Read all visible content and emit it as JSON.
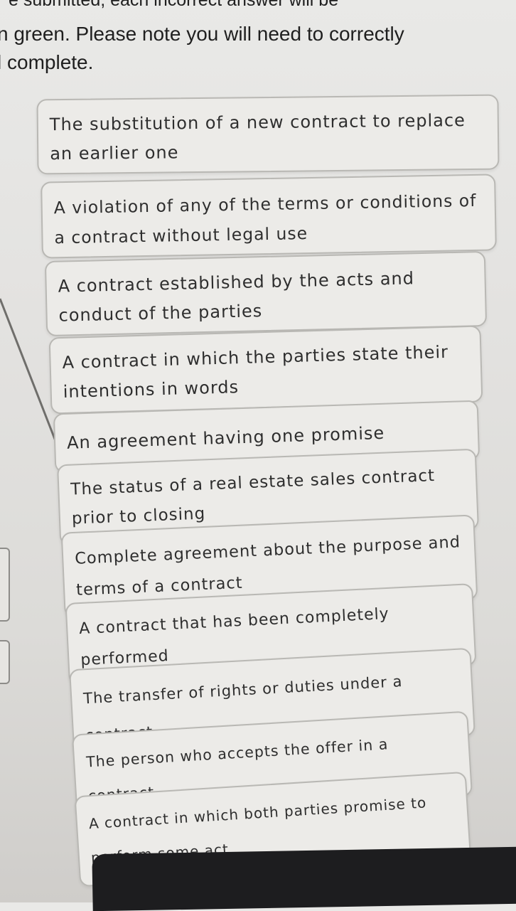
{
  "instructions": {
    "line1": "e submitted, each incorrect answer will be",
    "line2": "n green. Please note you will need to correctly",
    "line3": "l complete."
  },
  "cards": [
    {
      "text": "The substitution of a new contract to replace an earlier one"
    },
    {
      "text": "A violation of any of the terms or conditions of a contract without legal use"
    },
    {
      "text": "A contract established by the acts and conduct of the parties"
    },
    {
      "text": "A contract in which the parties state their intentions in words"
    },
    {
      "text": "An agreement having one promise"
    },
    {
      "text": "The status of a real estate sales contract prior to closing"
    },
    {
      "text": "Complete agreement about the purpose and terms of a contract"
    },
    {
      "text": "A contract that has been completely performed"
    },
    {
      "text": "The transfer of rights or duties under a contract"
    },
    {
      "text": "The person who accepts the offer in a contract"
    },
    {
      "text": "A contract in which both parties promise to perform some act"
    }
  ]
}
